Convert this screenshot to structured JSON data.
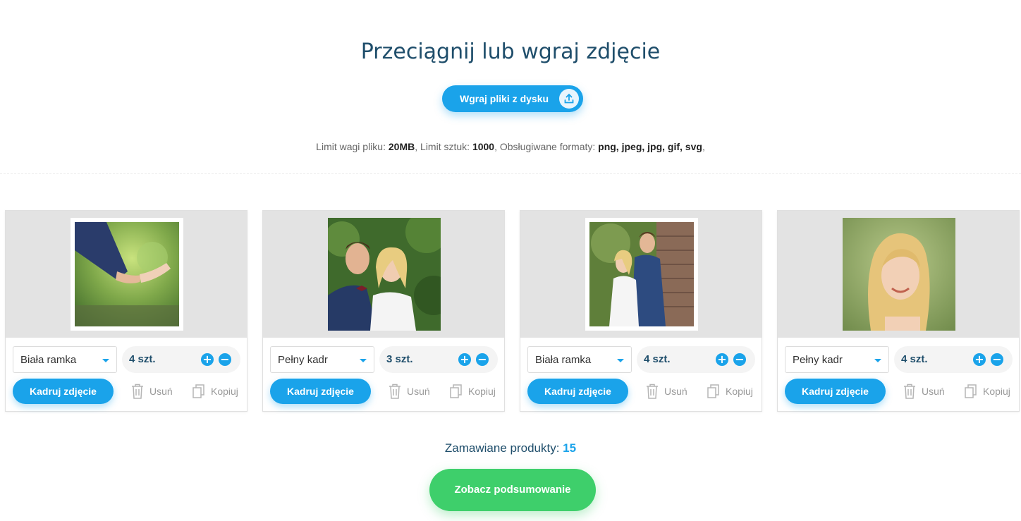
{
  "header": {
    "title": "Przeciągnij lub wgraj zdjęcie",
    "upload_button": "Wgraj pliki z dysku",
    "upload_icon": "upload-icon"
  },
  "limits": {
    "size_label": "Limit wagi pliku:",
    "size_value": "20MB",
    "count_label": ", Limit sztuk:",
    "count_value": "1000",
    "formats_label": ", Obsługiwane formaty:",
    "formats_value": "png, jpeg, jpg, gif, svg",
    "trailing": ","
  },
  "cards": [
    {
      "variant": "Biała ramka",
      "quantity": "4 szt.",
      "crop": "Kadruj zdjęcie",
      "delete": "Usuń",
      "copy": "Kopiuj"
    },
    {
      "variant": "Pełny kadr",
      "quantity": "3 szt.",
      "crop": "Kadruj zdjęcie",
      "delete": "Usuń",
      "copy": "Kopiuj"
    },
    {
      "variant": "Biała ramka",
      "quantity": "4 szt.",
      "crop": "Kadruj zdjęcie",
      "delete": "Usuń",
      "copy": "Kopiuj"
    },
    {
      "variant": "Pełny kadr",
      "quantity": "4 szt.",
      "crop": "Kadruj zdjęcie",
      "delete": "Usuń",
      "copy": "Kopiuj"
    }
  ],
  "summary": {
    "ordered_label": "Zamawiane produkty:",
    "ordered_count": "15",
    "button": "Zobacz podsumowanie"
  },
  "colors": {
    "accent": "#1aa3ea",
    "title": "#1f4e6b",
    "success": "#3ecf6b"
  }
}
